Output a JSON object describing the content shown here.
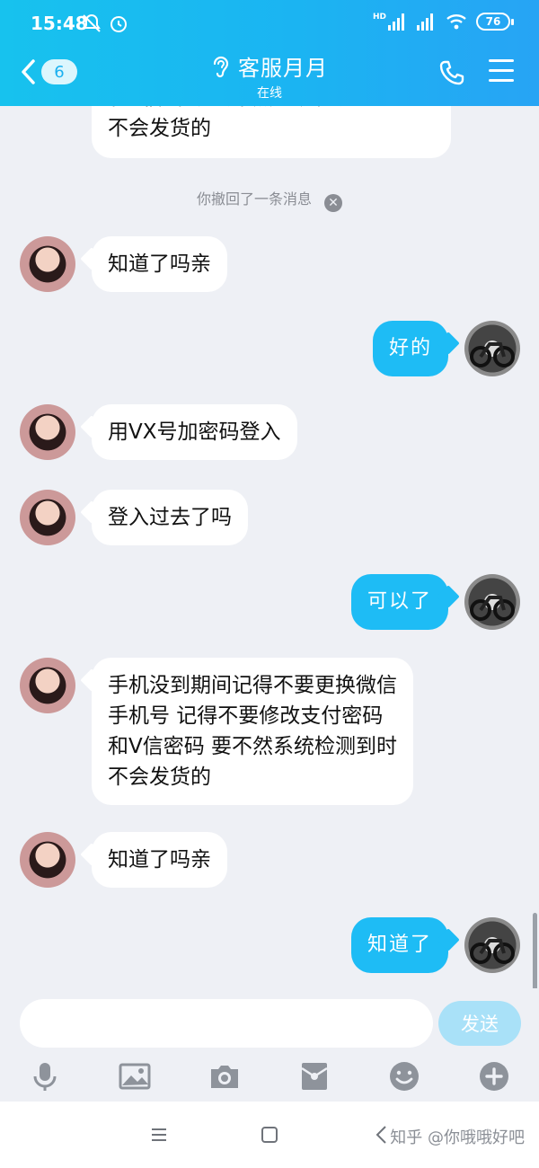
{
  "status_bar": {
    "time": "15:48",
    "battery": "76",
    "signal_tag": "HD"
  },
  "header": {
    "back_count": "6",
    "title": "客服月月",
    "subtitle": "在线"
  },
  "messages": [
    {
      "side": "left",
      "lines": [
        "和V信密码 要不然系统检测到时",
        "不会发货的"
      ]
    },
    {
      "side": "left",
      "lines": [
        "知道了吗亲"
      ]
    },
    {
      "side": "right",
      "lines": [
        "好的"
      ]
    },
    {
      "side": "left",
      "lines": [
        "用VX号加密码登入"
      ]
    },
    {
      "side": "left",
      "lines": [
        "登入过去了吗"
      ]
    },
    {
      "side": "right",
      "lines": [
        "可以了"
      ]
    },
    {
      "side": "left",
      "lines": [
        "手机没到期间记得不要更换微信",
        "手机号 记得不要修改支付密码",
        "和V信密码 要不然系统检测到时",
        "不会发货的"
      ]
    },
    {
      "side": "left",
      "lines": [
        "知道了吗亲"
      ]
    },
    {
      "side": "right",
      "lines": [
        "知道了"
      ]
    }
  ],
  "recall_notice": "你撤回了一条消息",
  "composer": {
    "placeholder": "",
    "send_label": "发送"
  },
  "toolbar_icons": [
    "microphone-icon",
    "image-icon",
    "camera-icon",
    "red-packet-icon",
    "emoji-icon",
    "plus-icon"
  ],
  "system_nav_icons": [
    "menu-icon",
    "home-icon",
    "back-icon"
  ],
  "watermark": "知乎 @你哦哦好吧",
  "colors": {
    "header": "#1bb4f2",
    "my_bubble": "#1ebcf5",
    "background": "#eef0f5",
    "send_button": "#a9e1f8"
  }
}
